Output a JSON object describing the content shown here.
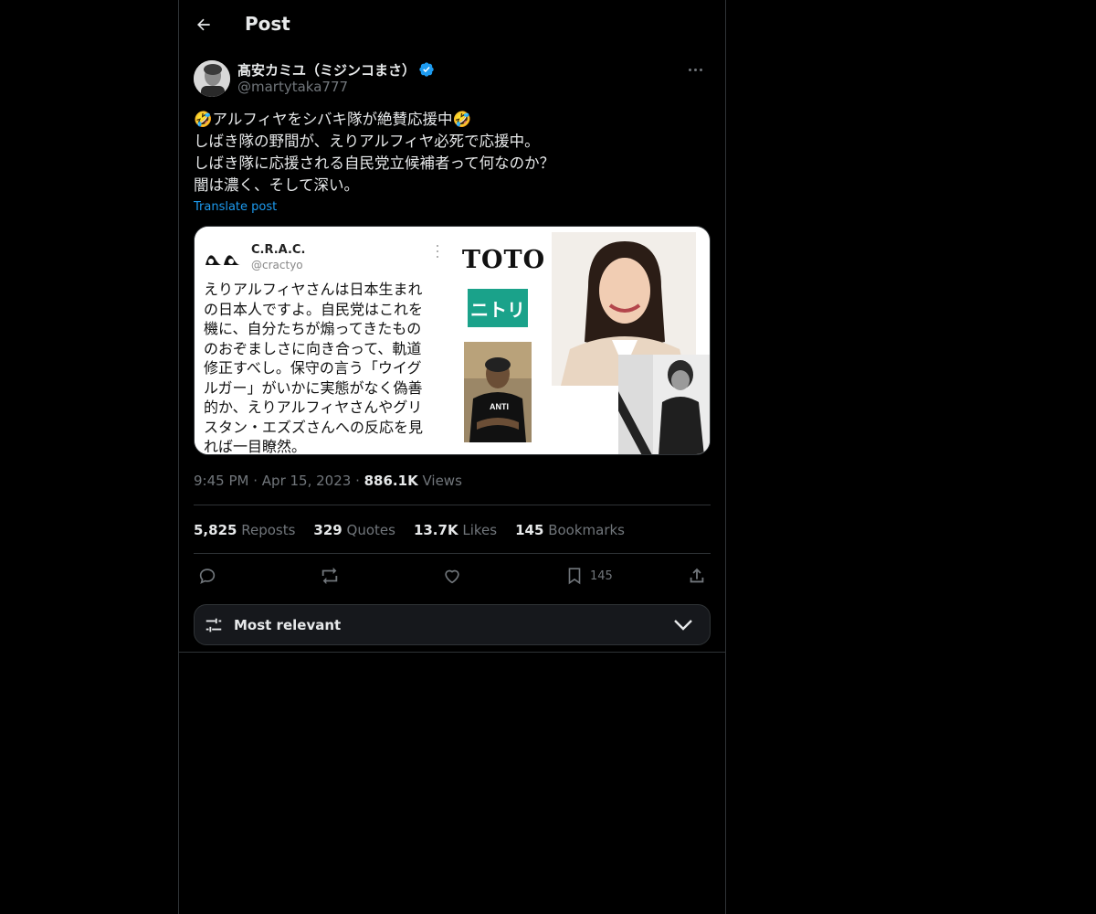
{
  "header": {
    "title": "Post"
  },
  "author": {
    "display_name": "髙安カミユ（ミジンコまさ）",
    "handle": "@martytaka777"
  },
  "post": {
    "lines": [
      "🤣アルフィヤをシバキ隊が絶賛応援中🤣",
      "しばき隊の野間が、えりアルフィヤ必死で応援中。",
      "しばき隊に応援される自民党立候補者って何なのか？",
      "闇は濃く、そして深い。"
    ],
    "translate_label": "Translate post",
    "time": "9:45 PM",
    "date": "Apr 15, 2023",
    "views_count": "886.1K",
    "views_label": "Views"
  },
  "media": {
    "embedded_name": "C.R.A.C.",
    "embedded_handle": "@cractyo",
    "embedded_lines": [
      "えりアルフィヤさんは日本生まれ",
      "の日本人ですよ。自民党はこれを",
      "機に、自分たちが煽ってきたもの",
      "のおぞましさに向き合って、軌道",
      "修正すべし。保守の言う「ウイグ",
      "ルガー」がいかに実態がなく偽善",
      "的か、えりアルフィヤさんやグリ",
      "スタン・エズズさんへの反応を見",
      "れば一目瞭然。"
    ],
    "toto_text": "TOTO",
    "nitori_text": "ニトリ",
    "shirt_text": "ANTI"
  },
  "stats": {
    "reposts": {
      "count": "5,825",
      "label": "Reposts"
    },
    "quotes": {
      "count": "329",
      "label": "Quotes"
    },
    "likes": {
      "count": "13.7K",
      "label": "Likes"
    },
    "bookmarks": {
      "count": "145",
      "label": "Bookmarks"
    }
  },
  "actions": {
    "bookmark_count": "145"
  },
  "sort": {
    "label": "Most relevant"
  },
  "colors": {
    "accent": "#1d9bf0",
    "background": "#000000",
    "muted": "#71767b",
    "border": "#2f3336"
  }
}
